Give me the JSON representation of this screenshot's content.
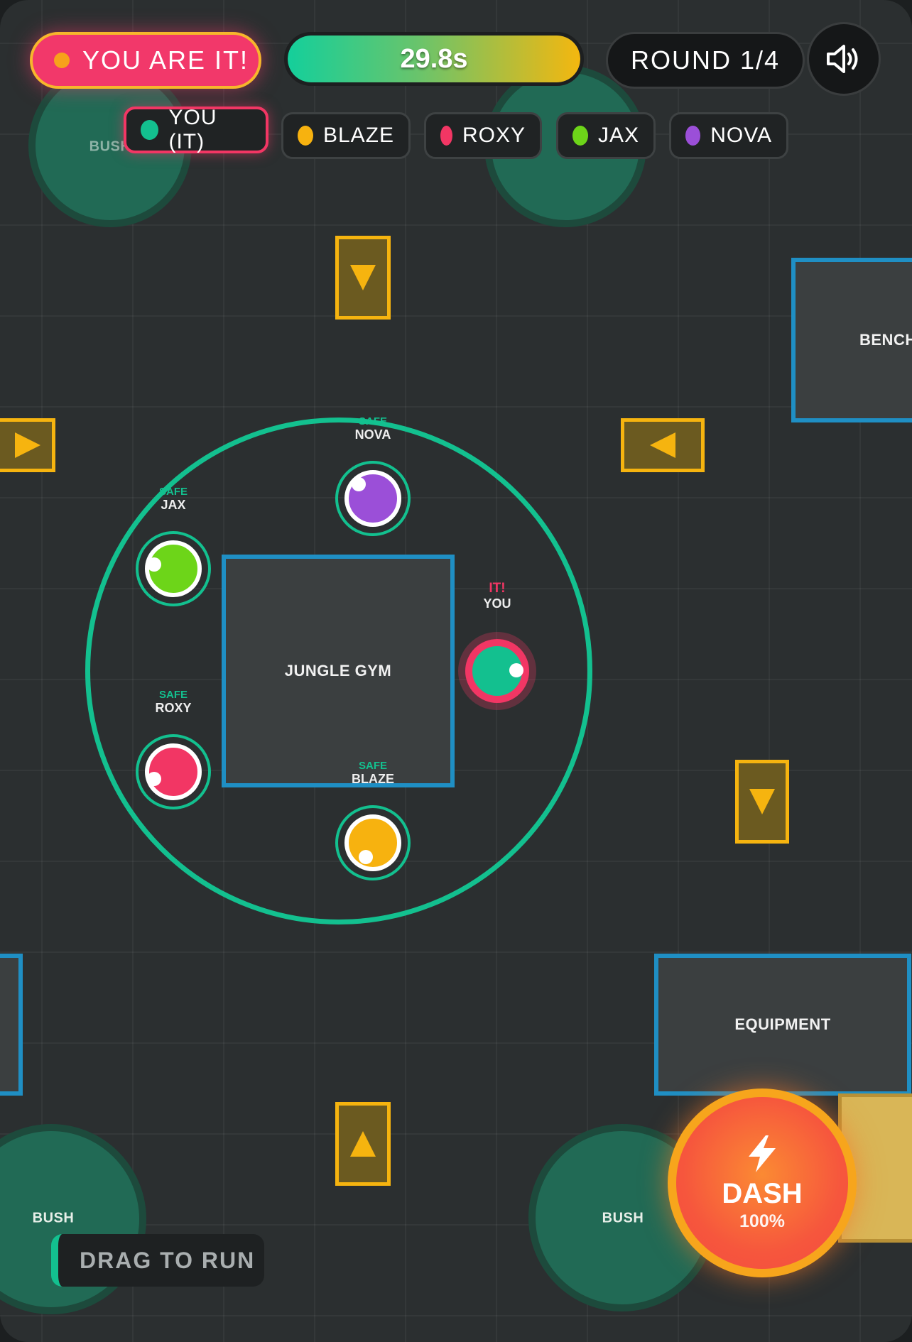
{
  "hud": {
    "status_banner": "YOU ARE IT!",
    "timer_text": "29.8s",
    "timer_fraction": 1.0,
    "round_text": "ROUND 1/4",
    "sound_icon": "speaker-volume-icon"
  },
  "roster": [
    {
      "label": "YOU (IT)",
      "color": "#13c08f"
    },
    {
      "label": "BLAZE",
      "color": "#f7b20f"
    },
    {
      "label": "ROXY",
      "color": "#f23664"
    },
    {
      "label": "JAX",
      "color": "#6dd519"
    },
    {
      "label": "NOVA",
      "color": "#9b4fd8"
    }
  ],
  "map": {
    "bushes": [
      "BUSH",
      "BUSH",
      "BUSH",
      "BUSH"
    ],
    "obstacles": {
      "jungle_gym": "JUNGLE GYM",
      "bench": "BENCH",
      "equipment": "EQUIPMENT"
    },
    "arrow_pads": [
      "down",
      "right",
      "left",
      "down",
      "up"
    ]
  },
  "players": {
    "you": {
      "it_tag": "IT!",
      "name": "YOU",
      "color": "#13c08f",
      "ring_color": "#f23664"
    },
    "nova": {
      "status": "SAFE",
      "name": "NOVA",
      "color": "#9b4fd8"
    },
    "jax": {
      "status": "SAFE",
      "name": "JAX",
      "color": "#6dd519"
    },
    "roxy": {
      "status": "SAFE",
      "name": "ROXY",
      "color": "#f23664"
    },
    "blaze": {
      "status": "SAFE",
      "name": "BLAZE",
      "color": "#f7b20f"
    }
  },
  "controls": {
    "drag_hint": "DRAG TO RUN",
    "dash_label": "DASH",
    "dash_charge": "100%",
    "dash_icon": "lightning-bolt-icon"
  }
}
